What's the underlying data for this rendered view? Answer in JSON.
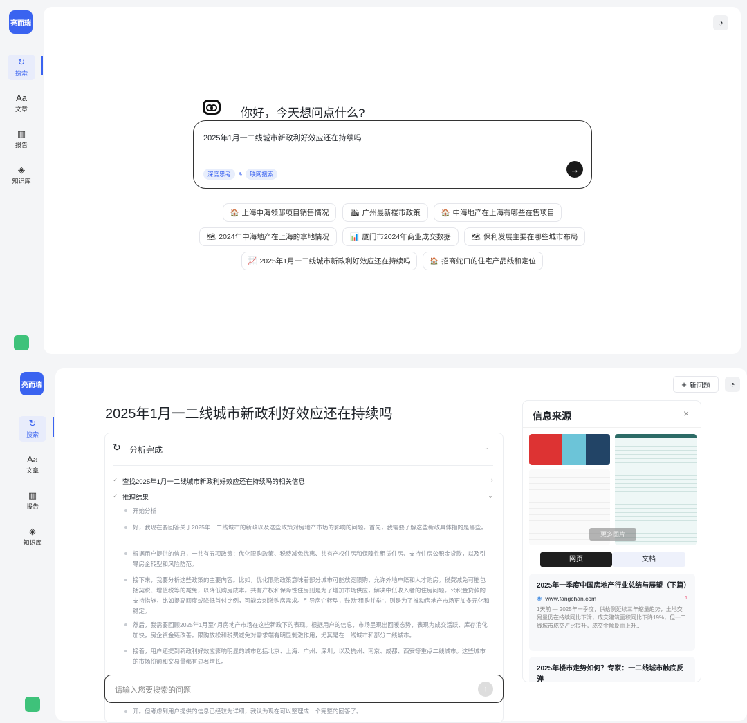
{
  "brand": {
    "logo_text": "亮而瑞"
  },
  "sidebar": {
    "items": [
      {
        "label": "搜索",
        "icon": "search-spark-icon"
      },
      {
        "label": "文章",
        "icon": "text-ai-icon"
      },
      {
        "label": "报告",
        "icon": "report-chart-icon"
      },
      {
        "label": "知识库",
        "icon": "cube-icon"
      }
    ]
  },
  "home": {
    "greeting": "你好，今天想问点什么?",
    "query": "2025年1月一二线城市新政利好效应还在持续吗",
    "mode_tags": [
      "深度思考",
      "联网搜索"
    ],
    "tag_joiner": "&",
    "suggestions": [
      {
        "icon": "🏠",
        "label": "上海中海领邸项目销售情况"
      },
      {
        "icon": "🏙",
        "label": "广州最新楼市政策"
      },
      {
        "icon": "🏠",
        "label": "中海地产在上海有哪些在售项目"
      },
      {
        "icon": "🗺",
        "label": "2024年中海地产在上海的拿地情况"
      },
      {
        "icon": "📊",
        "label": "厦门市2024年商业成交数据"
      },
      {
        "icon": "🗺",
        "label": "保利发展主要在哪些城市布局"
      },
      {
        "icon": "📈",
        "label": "2025年1月一二线城市新政利好效应还在持续吗"
      },
      {
        "icon": "🏠",
        "label": "招商蛇口的住宅产品线和定位"
      }
    ]
  },
  "result": {
    "title": "2025年1月一二线城市新政利好效应还在持续吗",
    "new_question": "新问题",
    "analysis_status": "分析完成",
    "steps": [
      "查找2025年1月一二线城市新政利好效应还在持续吗的相关信息",
      "推理结果"
    ],
    "reasoning": [
      "开始分析",
      "好，我现在要回答关于2025年一二线城市的新政以及这些政策对房地产市场的影响的问题。首先，我需要了解这些新政具体指的是哪些。",
      "根据用户提供的信息，一共有五项政策：优化限购政策、税费减免优惠、共有产权住房和保障性租赁住房、支持住房公积金贷款，以及引导房企转型和风险防范。",
      "接下来，我要分析这些政策的主要内容。比如，优化限购政策意味着部分城市可能放宽限购，允许外地户籍和人才购房。税费减免可能包括契税、增值税等的减免，以降低购房成本。共有产权和保障性住房则是为了增加市场供应，解决中低收入者的住房问题。公积金贷款的支持措施，比如提高额度或降低首付比例，可能会刺激购房需求。引导房企转型，鼓励“租购并举”，则是为了推动房地产市场更加多元化和稳定。",
      "然后，我需要回顾2025年1月至4月房地产市场在这些新政下的表现。根据用户的信息，市场呈现出回暖态势，表现为成交活跃、库存消化加快，房企资金链改善。限购放松和税费减免对需求端有明显刺激作用，尤其是在一线城市和部分二线城市。",
      "接着，用户还提到新政利好效应影响明显的城市包括北京、上海、广州、深圳，以及杭州、南京、成都、西安等重点二线城市。这些城市的市场份额和交易量都有显著增长。",
      "开。但考虑到用户提供的信息已经较为详细，我认为现在可以整理成一个完整的回答了。"
    ],
    "input_placeholder": "请输入您要搜索的问题"
  },
  "sources": {
    "title": "信息来源",
    "more_images": "更多图片",
    "tabs": [
      "网页",
      "文档"
    ],
    "items": [
      {
        "title": "2025年一季度中国房地产行业总结与展望（下篇）",
        "site": "www.fangchan.com",
        "index": "1",
        "snippet": "1天前 — 2025年一季度，供给侧延续三年缩量趋势，土地交易量仍在持续同比下滑，成交建筑面积同比下降19%，但一二线城市成交占比提升，成交金额反而上升..."
      },
      {
        "title": "2025年楼市走势如何？专家：一二线城市触底反弹"
      }
    ]
  },
  "colors": {
    "accent": "#3a63f0",
    "dark": "#1a1a1a"
  }
}
